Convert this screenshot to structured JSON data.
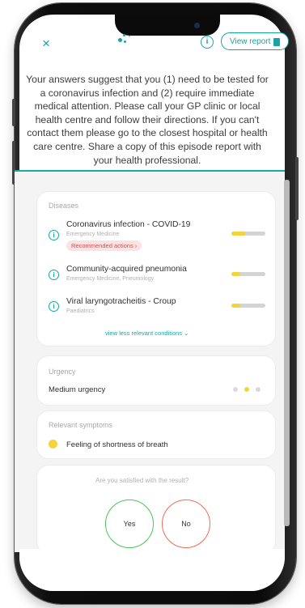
{
  "header": {
    "close_icon": "×",
    "info_icon": "i",
    "report_label": "View report"
  },
  "message": "Your answers suggest that you (1) need to be tested for a coronavirus infection and (2) require immediate medical attention. Please call your GP clinic or local health centre and follow their directions. If you can't contact them please go to the closest hospital or health care centre. Share a copy of this episode report with your health professional.",
  "diseases": {
    "title": "Diseases",
    "items": [
      {
        "name": "Coronavirus infection - COVID-19",
        "specialty": "Emergency Medicine",
        "badge": "Recommended actions ›",
        "likelihood": 0.4
      },
      {
        "name": "Community-acquired pneumonia",
        "specialty": "Emergency Medicine, Pneumology",
        "likelihood": 0.25
      },
      {
        "name": "Viral laryngotracheitis - Croup",
        "specialty": "Paediatrics",
        "likelihood": 0.25
      }
    ],
    "less_link": "view less relevant conditions ⌄"
  },
  "urgency": {
    "title": "Urgency",
    "value": "Medium urgency",
    "level": 2,
    "max_level": 3
  },
  "symptoms": {
    "title": "Relevant symptoms",
    "items": [
      "Feeling of shortness of breath"
    ]
  },
  "feedback": {
    "question": "Are you satisfied with the result?",
    "yes": "Yes",
    "no": "No"
  },
  "colors": {
    "accent": "#16a5a3",
    "likelihood": "#f2d43d",
    "yes_ring": "#4cc45a",
    "no_ring": "#f06b55",
    "badge_text": "#d94b4b"
  }
}
